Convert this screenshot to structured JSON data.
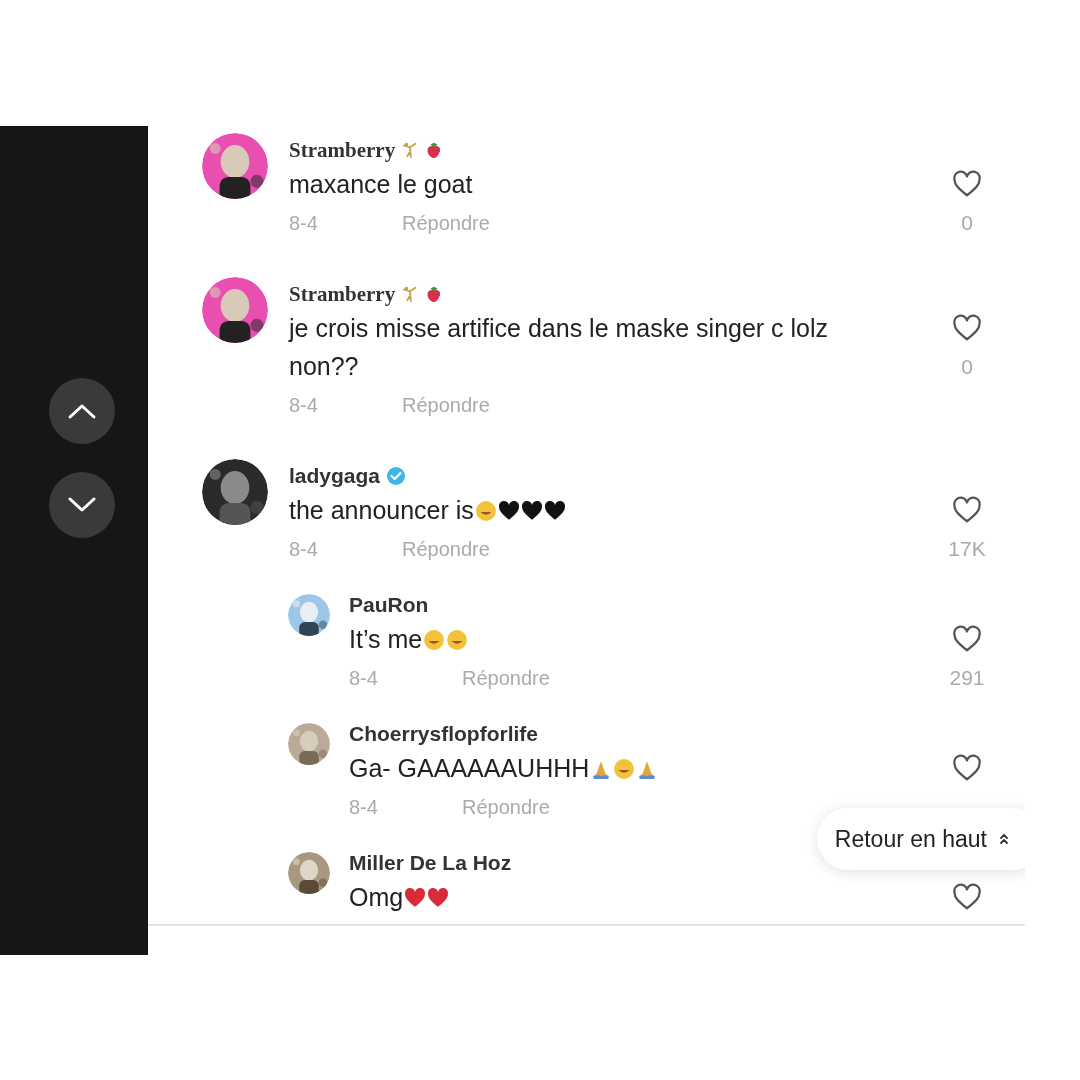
{
  "comments": [
    {
      "user": "Stramberry",
      "stylized_name": true,
      "verified": false,
      "name_emoji": [
        {
          "kind": "figure"
        },
        {
          "kind": "strawberry"
        }
      ],
      "text": "maxance le goat",
      "date": "8-4",
      "reply_label": "Répondre",
      "likes": "0"
    },
    {
      "user": "Stramberry",
      "stylized_name": true,
      "verified": false,
      "name_emoji": [
        {
          "kind": "figure"
        },
        {
          "kind": "strawberry"
        }
      ],
      "text": "je crois misse artifice dans le maske singer c lolz non??",
      "date": "8-4",
      "reply_label": "Répondre",
      "likes": "0"
    },
    {
      "user": "ladygaga",
      "stylized_name": false,
      "verified": true,
      "text": "the announcer is",
      "emoji": [
        {
          "kind": "face"
        },
        {
          "kind": "black-heart"
        },
        {
          "kind": "black-heart"
        },
        {
          "kind": "black-heart"
        }
      ],
      "date": "8-4",
      "reply_label": "Répondre",
      "likes": "17K",
      "replies": [
        {
          "user": "PauRon",
          "text": "It’s me",
          "emoji": [
            {
              "kind": "face"
            },
            {
              "kind": "face"
            }
          ],
          "date": "8-4",
          "reply_label": "Répondre",
          "likes": "291"
        },
        {
          "user": "Choerrysflopforlife",
          "text": "Ga- GAAAAAAUHHH",
          "emoji": [
            {
              "kind": "hands"
            },
            {
              "kind": "face"
            },
            {
              "kind": "hands"
            }
          ],
          "date": "8-4",
          "reply_label": "Répondre"
        },
        {
          "user": "Miller De La Hoz",
          "text": "Omg",
          "emoji": [
            {
              "kind": "red-heart"
            },
            {
              "kind": "red-heart"
            }
          ]
        }
      ]
    }
  ],
  "back_to_top": {
    "label": "Retour en haut"
  }
}
